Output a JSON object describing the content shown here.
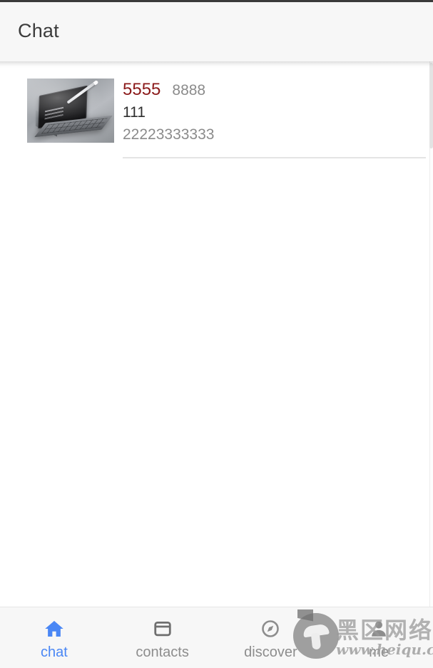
{
  "header": {
    "title": "Chat"
  },
  "chat_list": [
    {
      "thumbnail_alt": "tablet-with-stylus-product-photo",
      "name": "5555",
      "tag": "8888",
      "subject": "111",
      "preview": "22223333333"
    }
  ],
  "bottom_nav": {
    "items": [
      {
        "label": "chat",
        "icon": "home-icon",
        "active": true
      },
      {
        "label": "contacts",
        "icon": "window-icon",
        "active": false
      },
      {
        "label": "discover",
        "icon": "compass-icon",
        "active": false
      },
      {
        "label": "me",
        "icon": "person-icon",
        "active": false
      }
    ]
  },
  "watermark": {
    "brand": "黑区网络",
    "url": "www.heiqu.com"
  },
  "colors": {
    "header_bg": "#f7f7f7",
    "accent_blue": "#4a87f5",
    "name_red": "#8b1a1a",
    "muted_gray": "#8b8b8b",
    "text_dark": "#2e2e2e",
    "divider": "#e4e4e4",
    "nav_bg": "#f7f7f7"
  }
}
